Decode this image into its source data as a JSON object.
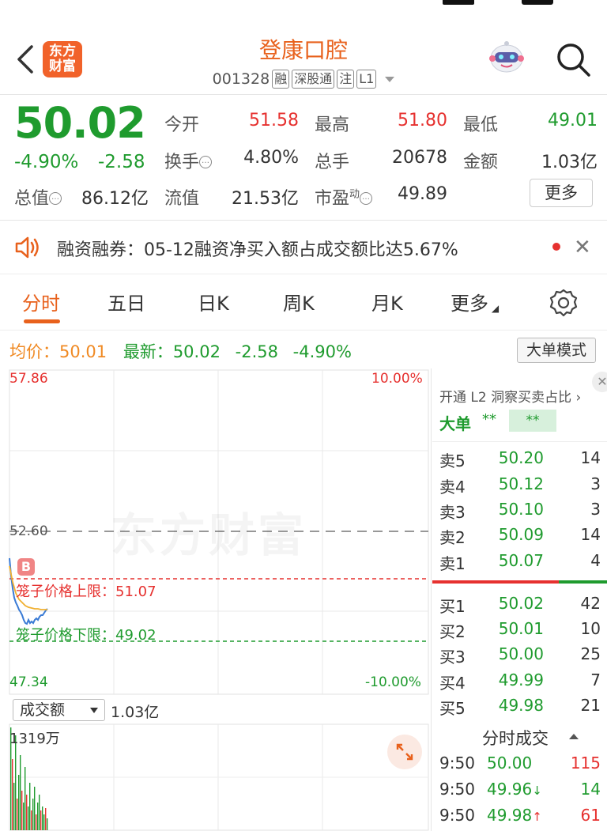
{
  "header": {
    "title": "登康口腔",
    "code": "001328",
    "tags": [
      "融",
      "深股通",
      "注",
      "L1"
    ],
    "logo_text": [
      "东方",
      "财富"
    ]
  },
  "quote": {
    "price": "50.02",
    "change_pct": "-4.90%",
    "change": "-2.58",
    "open_label": "今开",
    "open": "51.58",
    "high_label": "最高",
    "high": "51.80",
    "low_label": "最低",
    "low": "49.01",
    "turnover_label": "换手",
    "turnover": "4.80%",
    "volume_label": "总手",
    "volume": "20678",
    "amount_label": "金额",
    "amount": "1.03亿",
    "mktcap_label": "总值",
    "mktcap": "86.12亿",
    "float_label": "流值",
    "float": "21.53亿",
    "pe_label": "市盈",
    "pe_sup": "动",
    "pe": "49.89",
    "more": "更多"
  },
  "notice": {
    "text": "融资融券：05-12融资净买入额占成交额比达5.67%"
  },
  "tabs": [
    {
      "label": "分时"
    },
    {
      "label": "五日"
    },
    {
      "label": "日K"
    },
    {
      "label": "周K"
    },
    {
      "label": "月K"
    },
    {
      "label": "更多"
    }
  ],
  "info": {
    "avg_label": "均价：",
    "avg": "50.01",
    "latest_label": "最新：",
    "latest": "50.02",
    "chg": "-2.58",
    "pct": "-4.90%",
    "mode_button": "大单模式"
  },
  "chart": {
    "y_max": "57.86",
    "y_mid": "52.60",
    "y_min": "47.34",
    "pct_max": "10.00%",
    "pct_min": "-10.00%",
    "watermark": "东方财富",
    "badge": "B",
    "cage_up": "笼子价格上限：51.07",
    "cage_down": "笼子价格下限：49.02",
    "vol_select": "成交额",
    "vol_total": "1.03亿",
    "vol_max": "1319万",
    "colors": {
      "up": "#e6312f",
      "down": "#1f9b2e",
      "price_line": "#3a7bd5",
      "avg_line": "#f0b030"
    }
  },
  "panel": {
    "l2_link": "开通 L2 洞察买卖占比 ›",
    "big_label": "大单",
    "big_v1": "**",
    "big_v2": "**",
    "sell": [
      {
        "label": "卖5",
        "price": "50.20",
        "vol": "14"
      },
      {
        "label": "卖4",
        "price": "50.12",
        "vol": "3"
      },
      {
        "label": "卖3",
        "price": "50.10",
        "vol": "3"
      },
      {
        "label": "卖2",
        "price": "50.09",
        "vol": "14"
      },
      {
        "label": "卖1",
        "price": "50.07",
        "vol": "4"
      }
    ],
    "buy": [
      {
        "label": "买1",
        "price": "50.02",
        "vol": "42"
      },
      {
        "label": "买2",
        "price": "50.01",
        "vol": "10"
      },
      {
        "label": "买3",
        "price": "50.00",
        "vol": "25"
      },
      {
        "label": "买4",
        "price": "49.99",
        "vol": "7"
      },
      {
        "label": "买5",
        "price": "49.98",
        "vol": "21"
      }
    ],
    "trades_title": "分时成交",
    "trades": [
      {
        "time": "9:50",
        "price": "50.00",
        "arrow": "",
        "vol": "115",
        "dir": "up"
      },
      {
        "time": "9:50",
        "price": "49.96",
        "arrow": "↓",
        "vol": "14",
        "dir": "down"
      },
      {
        "time": "9:50",
        "price": "49.98",
        "arrow": "↑",
        "vol": "61",
        "dir": "up"
      }
    ]
  }
}
